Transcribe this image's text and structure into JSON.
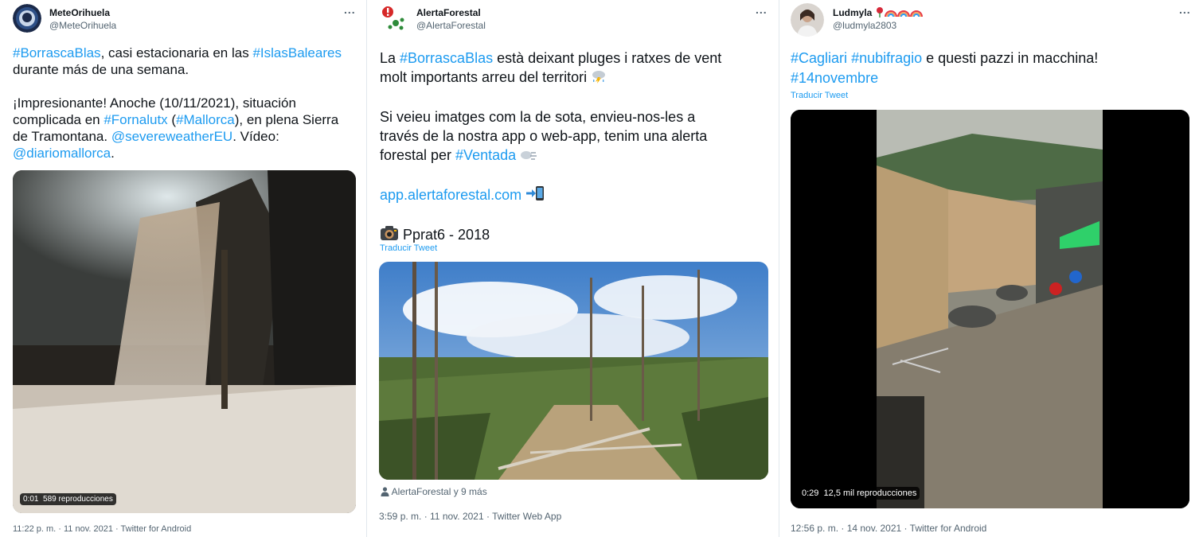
{
  "tweets": [
    {
      "name": "MeteOrihuela",
      "handle": "@MeteOrihuela",
      "more_icon": "...",
      "text": {
        "l1_a": "#BorrascaBlas",
        "l1_b": ", casi estacionaria en las ",
        "l1_c": "#IslasBaleares",
        "l2": "durante más de una semana.",
        "l3": "¡Impresionante! Anoche (10/11/2021), situación",
        "l4_a": "complicada en ",
        "l4_b": "#Fornalutx",
        "l4_c": " (",
        "l4_d": "#Mallorca",
        "l4_e": "), en plena Sierra",
        "l5_a": "de Tramontana. ",
        "l5_b": "@severeweatherEU",
        "l5_c": ". Vídeo:",
        "l6_a": "@diariomallorca",
        "l6_b": "."
      },
      "video": {
        "time": "0:01",
        "views": "589 reproducciones"
      },
      "footer": "11:22 p. m. · 11 nov. 2021 · Twitter for Android"
    },
    {
      "name": "AlertaForestal",
      "handle": "@AlertaForestal",
      "more_icon": "...",
      "text": {
        "l1_a": "La ",
        "l1_b": "#BorrascaBlas",
        "l1_c": " està deixant pluges i ratxes de vent",
        "l2": "molt importants arreu del territori",
        "l3": "Si veieu imatges com la de sota, envieu-nos-les a",
        "l4": "través de la nostra app o web-app, tenim una alerta",
        "l5_a": "forestal per ",
        "l5_b": "#Ventada",
        "l6": "app.alertaforestal.com",
        "l7": "Pprat6 - 2018"
      },
      "translate": "Traducir Tweet",
      "tagged": "AlertaForestal y 9 más",
      "footer": "3:59 p. m. · 11 nov. 2021 · Twitter Web App"
    },
    {
      "name": "Ludmyla",
      "handle": "@ludmyla2803",
      "more_icon": "...",
      "text": {
        "l1_a": "#Cagliari",
        "l1_b": " ",
        "l1_c": "#nubifragio",
        "l1_d": " e questi pazzi in macchina!",
        "l2": "#14novembre"
      },
      "translate": "Traducir Tweet",
      "video": {
        "time": "0:29",
        "views": "12,5 mil reproducciones"
      },
      "footer": "12:56 p. m. · 14 nov. 2021 · Twitter for Android"
    }
  ],
  "colors": {
    "link": "#1d9bf0",
    "muted": "#536471",
    "text": "#0f1419",
    "border": "#e1e8ed"
  }
}
